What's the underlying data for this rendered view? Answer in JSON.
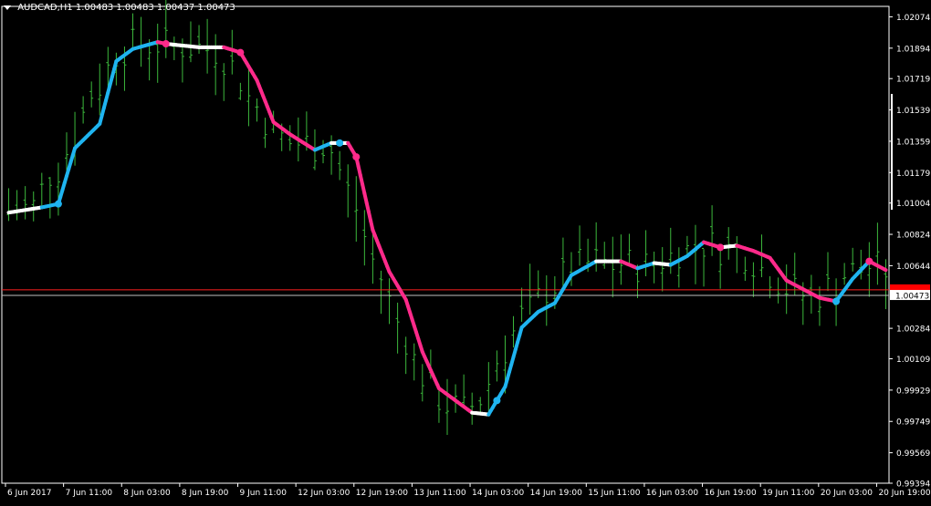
{
  "header": {
    "symbol_tf": "AUDCAD,H1",
    "ohlc": "1.00483 1.00483 1.00437 1.00473"
  },
  "colors": {
    "background": "#000000",
    "frame": "#ffffff",
    "bars": "#3cb83c",
    "ma_up": "#1fb4f0",
    "ma_down": "#ff2a8a",
    "ma_flat": "#ffffff",
    "bid_line": "#c0c0c0",
    "ask_line": "#ff2020",
    "price_box": "#ffffff",
    "ask_box": "#ff0000"
  },
  "chart_data": {
    "type": "line",
    "ylim": [
      0.99394,
      1.02134
    ],
    "y_ticks": [
      "1.02074",
      "1.01894",
      "1.01719",
      "1.01539",
      "1.01359",
      "1.01179",
      "1.01004",
      "1.00824",
      "1.00644",
      "1.00284",
      "1.00109",
      "0.99929",
      "0.99749",
      "0.99569",
      "0.99394"
    ],
    "x_ticks": [
      "6 Jun 2017",
      "7 Jun 11:00",
      "8 Jun 03:00",
      "8 Jun 19:00",
      "9 Jun 11:00",
      "12 Jun 03:00",
      "12 Jun 19:00",
      "13 Jun 11:00",
      "14 Jun 03:00",
      "14 Jun 19:00",
      "15 Jun 11:00",
      "16 Jun 03:00",
      "16 Jun 19:00",
      "19 Jun 11:00",
      "20 Jun 03:00",
      "20 Jun 19:00"
    ],
    "current_price": "1.00473",
    "bid_price": 1.00473,
    "ask_price": 1.00505,
    "ma_series": [
      {
        "x": 0,
        "y": 1.00949
      },
      {
        "x": 4,
        "y": 1.00979
      },
      {
        "x": 6,
        "y": 1.00999
      },
      {
        "x": 8,
        "y": 1.01319
      },
      {
        "x": 11,
        "y": 1.01459
      },
      {
        "x": 13,
        "y": 1.01819
      },
      {
        "x": 15,
        "y": 1.01889
      },
      {
        "x": 18,
        "y": 1.01929
      },
      {
        "x": 19,
        "y": 1.01919
      },
      {
        "x": 23,
        "y": 1.01899
      },
      {
        "x": 26,
        "y": 1.01899
      },
      {
        "x": 28,
        "y": 1.01869
      },
      {
        "x": 30,
        "y": 1.01709
      },
      {
        "x": 32,
        "y": 1.01469
      },
      {
        "x": 34,
        "y": 1.01399
      },
      {
        "x": 37,
        "y": 1.01309
      },
      {
        "x": 39,
        "y": 1.01349
      },
      {
        "x": 41,
        "y": 1.01349
      },
      {
        "x": 42,
        "y": 1.01269
      },
      {
        "x": 44,
        "y": 1.00849
      },
      {
        "x": 46,
        "y": 1.00609
      },
      {
        "x": 48,
        "y": 1.00449
      },
      {
        "x": 50,
        "y": 1.00149
      },
      {
        "x": 52,
        "y": 0.99939
      },
      {
        "x": 56,
        "y": 0.99799
      },
      {
        "x": 58,
        "y": 0.99789
      },
      {
        "x": 60,
        "y": 0.99949
      },
      {
        "x": 62,
        "y": 1.00289
      },
      {
        "x": 64,
        "y": 1.00379
      },
      {
        "x": 66,
        "y": 1.00429
      },
      {
        "x": 68,
        "y": 1.00589
      },
      {
        "x": 71,
        "y": 1.00669
      },
      {
        "x": 74,
        "y": 1.00669
      },
      {
        "x": 76,
        "y": 1.00629
      },
      {
        "x": 78,
        "y": 1.00659
      },
      {
        "x": 80,
        "y": 1.00649
      },
      {
        "x": 82,
        "y": 1.00699
      },
      {
        "x": 84,
        "y": 1.00779
      },
      {
        "x": 86,
        "y": 1.00749
      },
      {
        "x": 88,
        "y": 1.00759
      },
      {
        "x": 90,
        "y": 1.00729
      },
      {
        "x": 92,
        "y": 1.00689
      },
      {
        "x": 94,
        "y": 1.00559
      },
      {
        "x": 96,
        "y": 1.00509
      },
      {
        "x": 98,
        "y": 1.00459
      },
      {
        "x": 100,
        "y": 1.00439
      },
      {
        "x": 102,
        "y": 1.00569
      },
      {
        "x": 104,
        "y": 1.00669
      },
      {
        "x": 106,
        "y": 1.00619
      }
    ]
  }
}
